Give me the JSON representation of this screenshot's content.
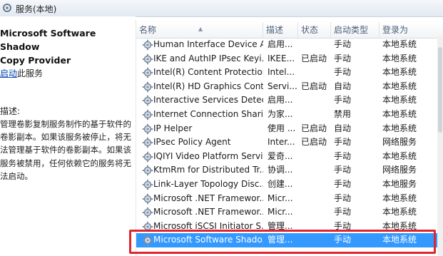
{
  "window": {
    "title": "服务(本地)",
    "icon": "services-icon"
  },
  "left_panel": {
    "service_name_line1": "Microsoft Software Shadow",
    "service_name_line2": "Copy Provider",
    "start_link": "启动",
    "start_suffix": "此服务",
    "description_label": "描述:",
    "description_lines": [
      "管理卷影复制服务制作的基于软件的",
      "卷影副本。如果该服务被停止，将无",
      "法管理基于软件的卷影副本。如果该",
      "服务被禁用，任何依赖它的服务将无",
      "法启动。"
    ]
  },
  "columns": {
    "name": "名称",
    "description": "描述",
    "status": "状态",
    "startup_type": "启动类型",
    "log_on_as": "登录为"
  },
  "rows": [
    {
      "name": "Human Interface Device A...",
      "description": "启用...",
      "status": "",
      "startup": "手动",
      "logon": "本地系统"
    },
    {
      "name": "IKE and AuthIP IPsec Keyi...",
      "description": "IKEE...",
      "status": "已启动",
      "startup": "手动",
      "logon": "本地系统"
    },
    {
      "name": "Intel(R) Content Protection...",
      "description": "Intel...",
      "status": "",
      "startup": "手动",
      "logon": "本地系统"
    },
    {
      "name": "Intel(R) HD Graphics Cont...",
      "description": "Servi...",
      "status": "已启动",
      "startup": "自动",
      "logon": "本地系统"
    },
    {
      "name": "Interactive Services Detect...",
      "description": "启用...",
      "status": "",
      "startup": "手动",
      "logon": "本地系统"
    },
    {
      "name": "Internet Connection Shari...",
      "description": "为家...",
      "status": "",
      "startup": "禁用",
      "logon": "本地系统"
    },
    {
      "name": "IP Helper",
      "description": "使用 ...",
      "status": "已启动",
      "startup": "自动",
      "logon": "本地系统"
    },
    {
      "name": "IPsec Policy Agent",
      "description": "Inter...",
      "status": "已启动",
      "startup": "手动",
      "logon": "网络服务"
    },
    {
      "name": "IQIYI Video Platform Servi...",
      "description": "爱奇...",
      "status": "",
      "startup": "手动",
      "logon": "本地系统"
    },
    {
      "name": "KtmRm for Distributed Tr...",
      "description": "协调...",
      "status": "",
      "startup": "手动",
      "logon": "网络服务"
    },
    {
      "name": "Link-Layer Topology Disc...",
      "description": "创建...",
      "status": "",
      "startup": "手动",
      "logon": "本地服务"
    },
    {
      "name": "Microsoft .NET Framewor...",
      "description": "Micr...",
      "status": "",
      "startup": "手动",
      "logon": "本地系统"
    },
    {
      "name": "Microsoft .NET Framewor...",
      "description": "Micr...",
      "status": "",
      "startup": "手动",
      "logon": "本地系统"
    },
    {
      "name": "Microsoft iSCSI Initiator S...",
      "description": "管理...",
      "status": "",
      "startup": "手动",
      "logon": "本地系统"
    },
    {
      "name": "Microsoft Software Shado...",
      "description": "管理...",
      "status": "",
      "startup": "手动",
      "logon": "本地系统",
      "selected": true
    }
  ],
  "colors": {
    "selection": "#3399ff",
    "highlight_box": "#e0262c",
    "link": "#0645ad"
  }
}
